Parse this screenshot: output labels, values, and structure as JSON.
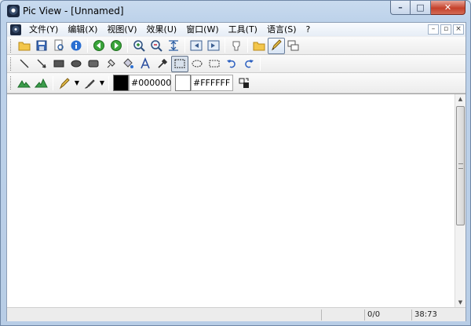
{
  "window": {
    "title": "Pic View - [Unnamed]",
    "min": "–",
    "max": "□",
    "close": "✕"
  },
  "menu": {
    "items": [
      "文件(Y)",
      "编辑(X)",
      "视图(V)",
      "效果(U)",
      "窗口(W)",
      "工具(T)",
      "语言(S)",
      "?"
    ],
    "mdi": {
      "min": "–",
      "restore": "▫",
      "close": "×"
    }
  },
  "colors": {
    "foreground": "#000000",
    "background": "#FFFFFF"
  },
  "status": {
    "cell1": "",
    "cell2": "",
    "cell3": "0/0",
    "cell4": "38:73"
  },
  "icons": {
    "tb1": [
      "open-folder-icon",
      "save-icon",
      "print-preview-icon",
      "info-icon",
      "prev-green-icon",
      "next-green-icon",
      "zoom-in-icon",
      "zoom-out-icon",
      "fit-icon",
      "back-icon",
      "forward-icon",
      "stamp-icon",
      "folder-icon",
      "pencil-edit-icon",
      "windows-icon"
    ],
    "tb2": [
      "line-icon",
      "arrow-line-icon",
      "rect-filled-icon",
      "ellipse-filled-icon",
      "rounded-rect-icon",
      "fill-pen-icon",
      "paint-bucket-icon",
      "text-icon",
      "eyedropper-icon",
      "rect-select-icon",
      "ellipse-select-icon",
      "rect-outline-icon",
      "undo-icon",
      "redo-icon"
    ],
    "tb3": [
      "mountain-left-icon",
      "mountain-right-icon",
      "pencil-icon",
      "brush-icon"
    ]
  }
}
